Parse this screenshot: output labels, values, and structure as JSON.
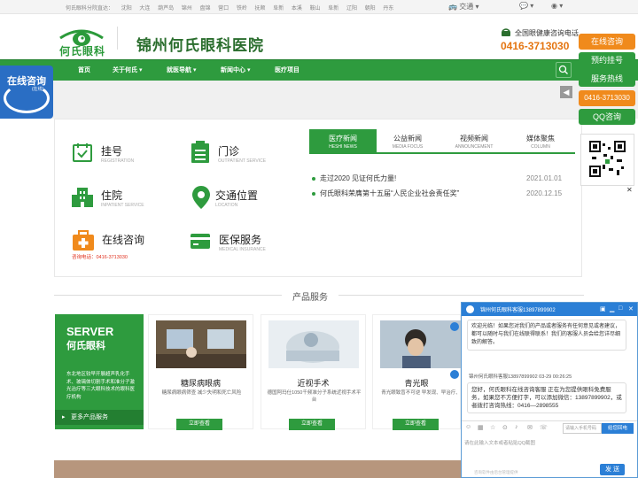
{
  "topbar": {
    "cities_label": "何氏眼科分院直达：",
    "cities": [
      "沈阳",
      "大连",
      "葫芦岛",
      "锦州",
      "盘锦",
      "营口",
      "铁岭",
      "抚顺",
      "阜新",
      "本溪",
      "鞍山",
      "阜新",
      "辽阳",
      "朝阳",
      "丹东"
    ],
    "traffic": "交通",
    "wechat": "",
    "weibo": ""
  },
  "header": {
    "logo_text": "何氏眼科",
    "hospital_name": "锦州何氏眼科医院",
    "phone_label": "全国眼健康咨询电话",
    "phone_number": "0416-3713030"
  },
  "nav": {
    "items": [
      "首页",
      "关于何氏",
      "就医导航",
      "新闻中心",
      "医疗项目"
    ]
  },
  "float_left": {
    "title": "在线咨询",
    "sub": "(在线)"
  },
  "services": [
    {
      "title": "挂号",
      "sub": "REGISTRATION"
    },
    {
      "title": "门诊",
      "sub": "OUTPATIENT SERVICE"
    },
    {
      "title": "住院",
      "sub": "INPATIENT SERVICE"
    },
    {
      "title": "交通位置",
      "sub": "LOCATION"
    },
    {
      "title": "在线咨询",
      "sub": "咨询电话：0416-3713030"
    },
    {
      "title": "医保服务",
      "sub": "MEDICAL INSURANCE"
    }
  ],
  "news_tabs": [
    {
      "cn": "医疗新闻",
      "en": "HESHI NEWS"
    },
    {
      "cn": "公益新闻",
      "en": "MEDIA FOCUS"
    },
    {
      "cn": "视频新闻",
      "en": "ANNOUNCEMENT"
    },
    {
      "cn": "媒体聚焦",
      "en": "COLUMN"
    }
  ],
  "news": [
    {
      "title": "走过2020 见证何氏力量!",
      "date": "2021.01.01"
    },
    {
      "title": "何氏眼科荣膺第十五届“人民企业社会责任奖”",
      "date": "2020.12.15"
    }
  ],
  "product_section": {
    "title": "产品服务"
  },
  "server_box": {
    "title1": "SERVER",
    "title2": "何氏眼科",
    "desc": "东北地区较早开展超声乳化手术、玻璃体切割手术和准分子激光治疗等三大眼科技术的眼科医疗机构",
    "more": "更多产品服务"
  },
  "products": [
    {
      "name": "糖尿病眼病",
      "desc": "糖尿病眼病筛查 减少失明和死亡风险",
      "button": "立即查看"
    },
    {
      "name": "近视手术",
      "desc": "德国阿玛仕1050千频准分子系统近视手术平台",
      "button": "立即查看"
    },
    {
      "name": "青光眼",
      "desc": "青光眼致盲不可逆 早发现、早治疗、早控",
      "button": "立即查看"
    }
  ],
  "right_panel": [
    {
      "label": "在线咨询",
      "color": "#f08a1c"
    },
    {
      "label": "预约挂号",
      "color": "#2e9b3e"
    },
    {
      "label": "服务热线",
      "color": "#2e9b3e"
    },
    {
      "label": "0416-3713030",
      "color": "#f08a1c"
    },
    {
      "label": "QQ咨询",
      "color": "#2e9b3e"
    }
  ],
  "chat": {
    "title": "锦州何氏眼科客服13897899902",
    "welcome": "欢迎光临！如果您对我们的产品或者服务有任何意见或者建议，都可以随时与我们在线联得联系！我们的客服人员会给您详尽细致的解答。",
    "agent_line": "锦州何氏眼科客服13897899902 03-29 00:26:25",
    "agent_msg": "您好，何氏眼科在线咨询客服 正在为您提供眼科免费服务，如果您不方便打字，可以添加微信：13897899902，或者拨打咨询热线：0416—2898555",
    "phone_placeholder": "请输入手机号码",
    "phone_button": "给您回电",
    "input_placeholder": "请在此输入文本或者粘贴QQ截图",
    "footer": "咨询软件由后台管理提供",
    "send": "发 送"
  }
}
